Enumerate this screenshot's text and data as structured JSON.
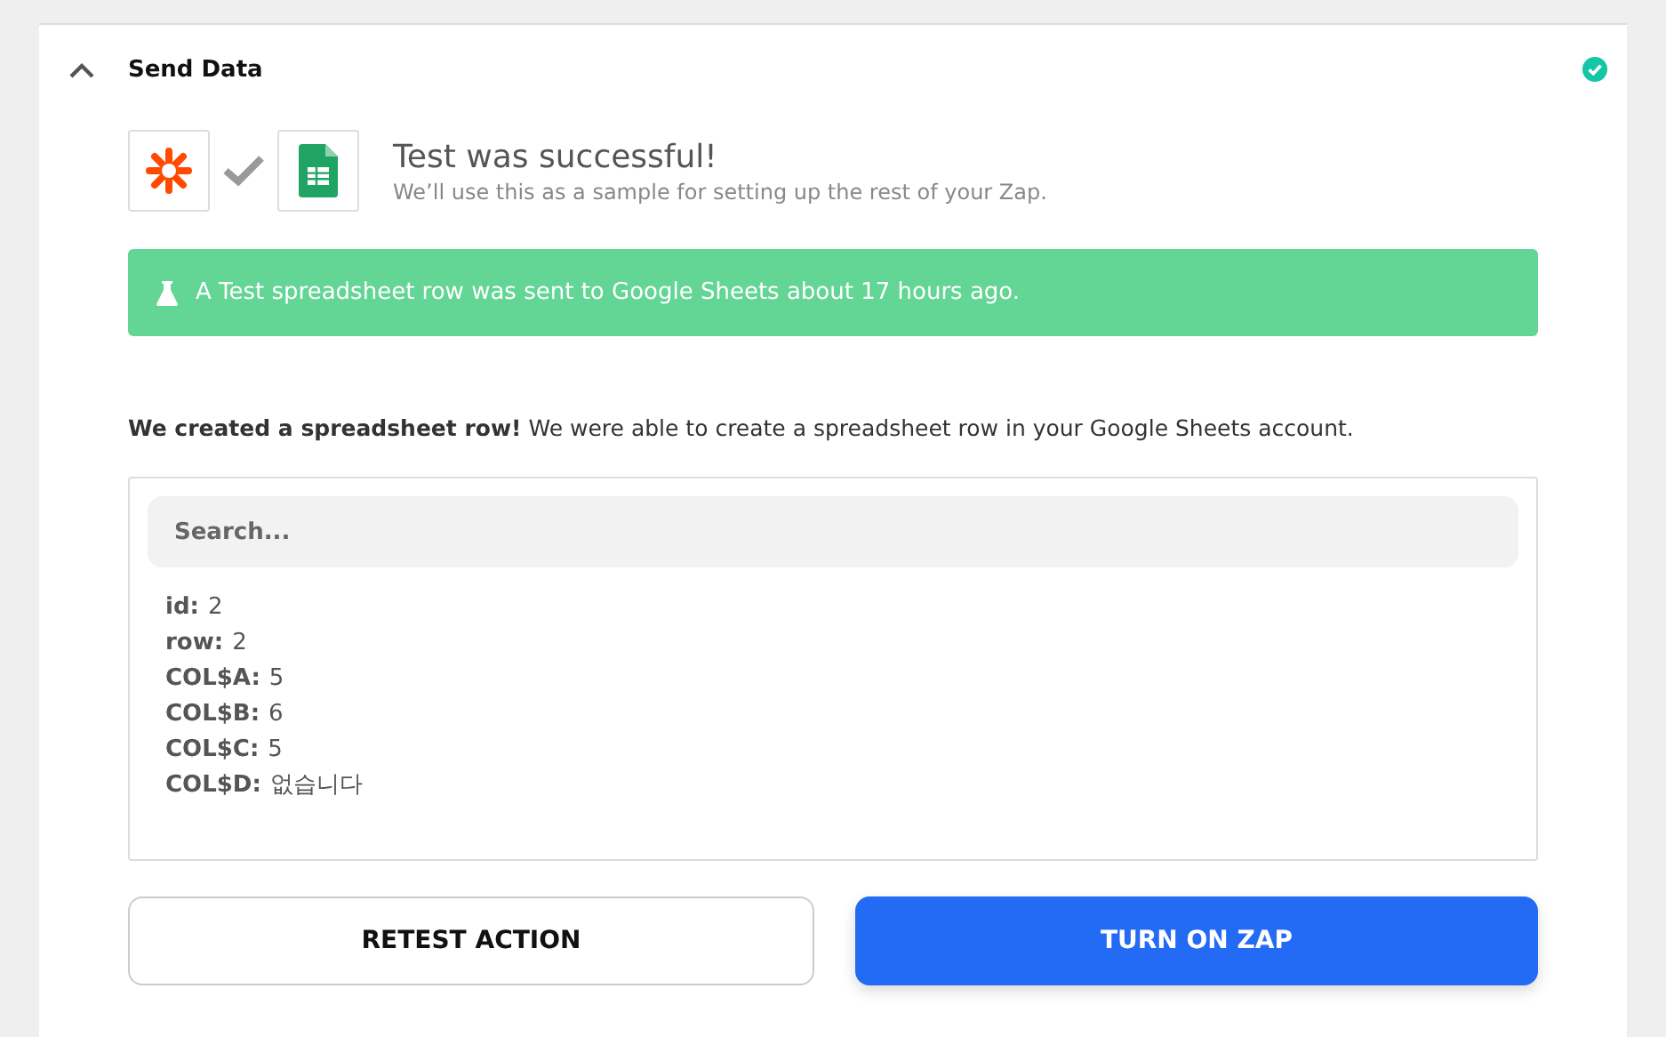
{
  "section": {
    "title": "Send Data",
    "expanded": true,
    "complete": true
  },
  "test": {
    "title": "Test was successful!",
    "subtitle": "We’ll use this as a sample for setting up the rest of your Zap."
  },
  "banner": {
    "text": "A Test spreadsheet row was sent to Google Sheets about 17 hours ago."
  },
  "message": "**We created a spreadsheet row!** We were able to create a spreadsheet row in your Google Sheets account.",
  "search": {
    "placeholder": "Search..."
  },
  "fields": [
    {
      "label": "id:",
      "value": "2"
    },
    {
      "label": "row:",
      "value": "2"
    },
    {
      "label": "COL$A:",
      "value": "5"
    },
    {
      "label": "COL$B:",
      "value": "6"
    },
    {
      "label": "COL$C:",
      "value": "5"
    },
    {
      "label": "COL$D:",
      "value": "없습니다"
    }
  ],
  "buttons": [
    {
      "label": "RETEST ACTION",
      "kind": "secondary"
    },
    {
      "label": "TURN ON ZAP",
      "kind": "primary"
    }
  ]
}
